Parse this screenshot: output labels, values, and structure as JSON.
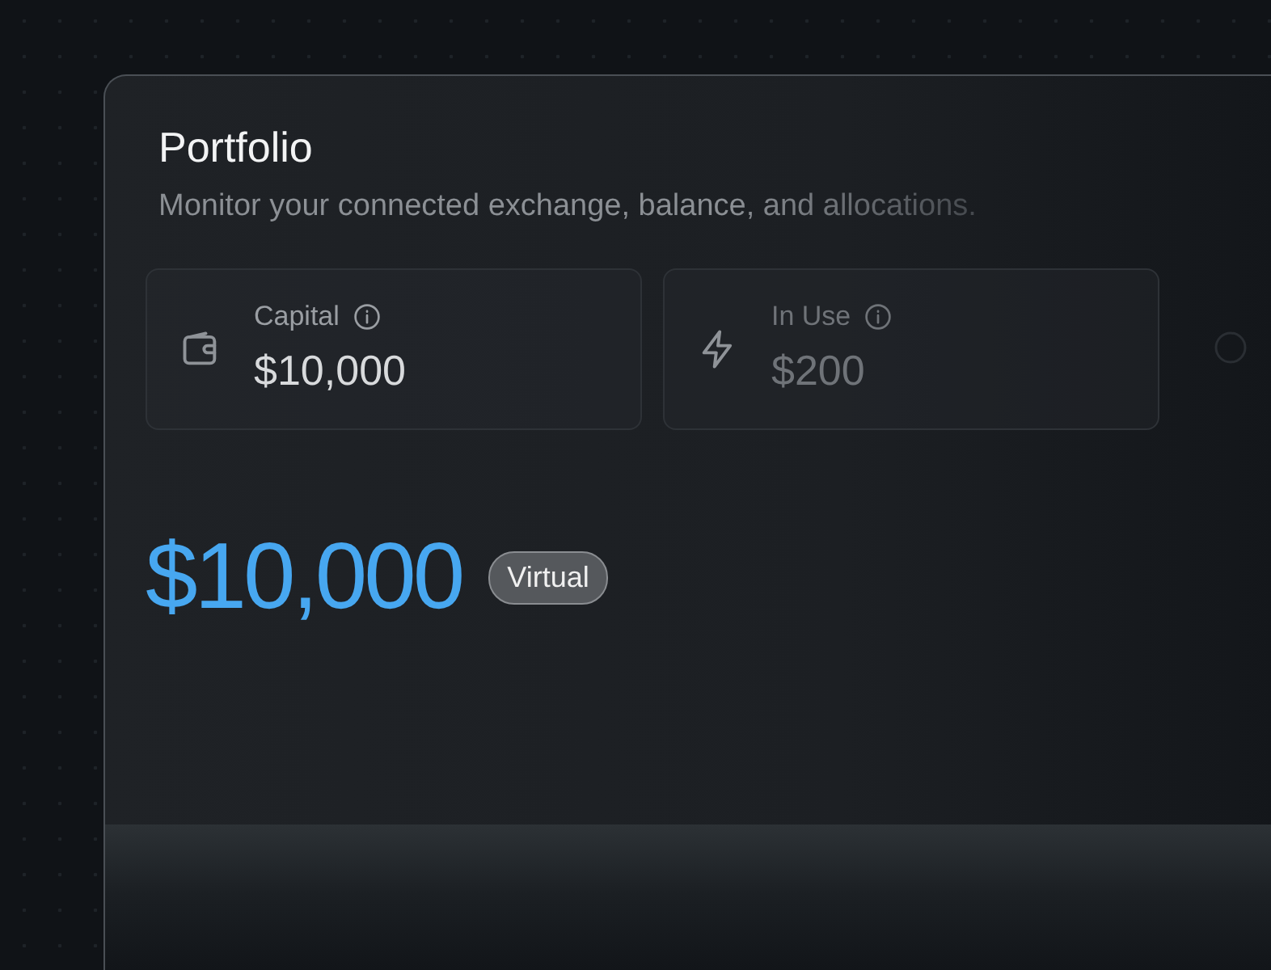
{
  "title": "Portfolio",
  "subtitle": "Monitor your connected exchange, balance, and allocations.",
  "stats": [
    {
      "kind": "wallet",
      "label": "Capital",
      "value": "$10,000",
      "muted": false
    },
    {
      "kind": "bolt",
      "label": "In Use",
      "value": "$200",
      "muted": true
    }
  ],
  "balance": {
    "amount": "$10,000",
    "badge": "Virtual"
  }
}
